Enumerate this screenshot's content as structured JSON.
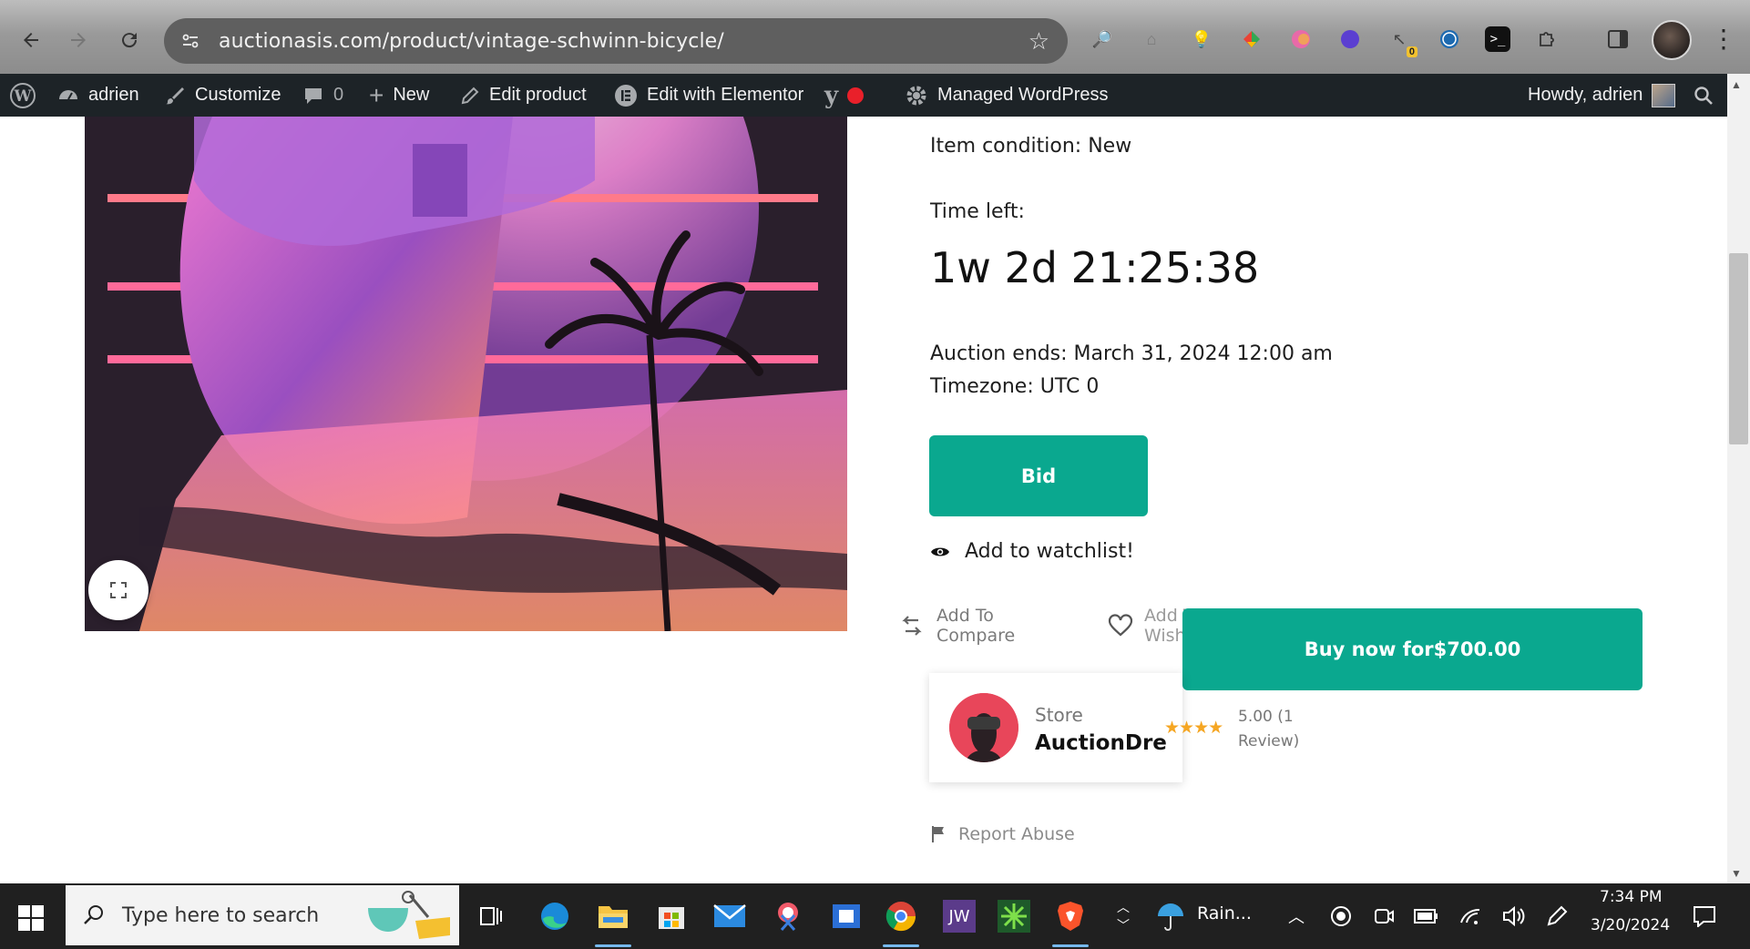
{
  "browser": {
    "url": "auctionasis.com/product/vintage-schwinn-bicycle/",
    "extension_badge": "0"
  },
  "admin_bar": {
    "user": "adrien",
    "customize": "Customize",
    "comments_count": "0",
    "new": "New",
    "edit_product": "Edit product",
    "edit_elementor": "Edit with Elementor",
    "managed_wp": "Managed WordPress",
    "howdy": "Howdy, adrien"
  },
  "product": {
    "condition": "Item condition: New",
    "time_left_label": "Time left:",
    "countdown": "1w 2d 21:25:38",
    "auction_ends": "Auction ends: March 31, 2024 12:00 am",
    "timezone": "Timezone: UTC 0",
    "bid_label": "Bid",
    "watchlist_label": "Add to watchlist!",
    "compare_line1": "Add To",
    "compare_line2": "Compare",
    "wishlist_line1": "Add To",
    "wishlist_line2": "Wishlist",
    "buy_now_label": "Buy now for$700.00",
    "store_label": "Store",
    "store_name": "AuctionDre",
    "rating_line1": "5.00 (1",
    "rating_line2": "Review)",
    "stars": "★★★★",
    "report_abuse": "Report Abuse"
  },
  "taskbar": {
    "search_placeholder": "Type here to search",
    "weather": "Rain...",
    "time": "7:34 PM",
    "date": "3/20/2024",
    "jw_label": "JW"
  },
  "colors": {
    "accent_green": "#0aa88f",
    "admin_bar_bg": "#1d2327",
    "taskbar_bg": "#202020"
  }
}
